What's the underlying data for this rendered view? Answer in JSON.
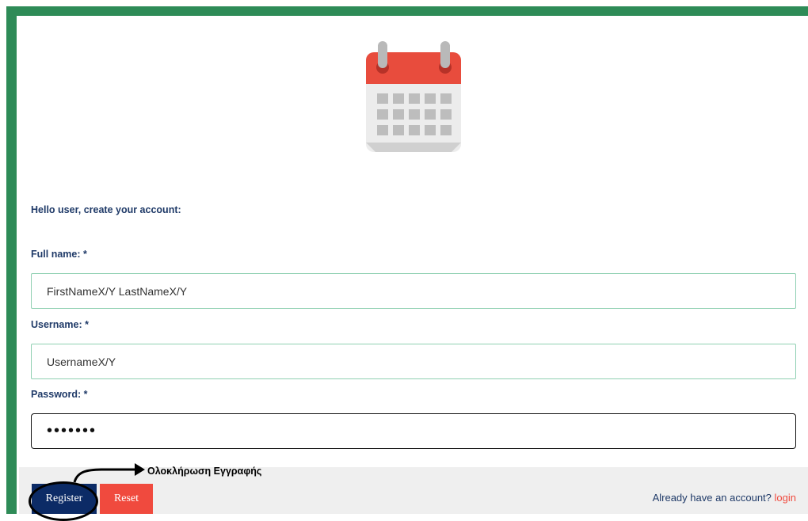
{
  "header": {
    "icon": "calendar-icon"
  },
  "form": {
    "greeting": "Hello user, create your account:",
    "full_name": {
      "label": "Full name: *",
      "value": "FirstNameX/Y LastNameX/Y"
    },
    "username": {
      "label": "Username: *",
      "value": "UsernameX/Y"
    },
    "password": {
      "label": "Password: *",
      "value": "•••••••"
    }
  },
  "footer": {
    "register_label": "Register",
    "reset_label": "Reset",
    "login_prompt": "Already have an account?",
    "login_link": "login"
  },
  "annotation": {
    "text": "Ολοκλήρωση Εγγραφής"
  },
  "colors": {
    "frame": "#2e8b57",
    "label": "#1f3a68",
    "register": "#0c2b66",
    "reset": "#f04a3e",
    "calendar_header": "#e84c3d",
    "calendar_body": "#ececec"
  }
}
